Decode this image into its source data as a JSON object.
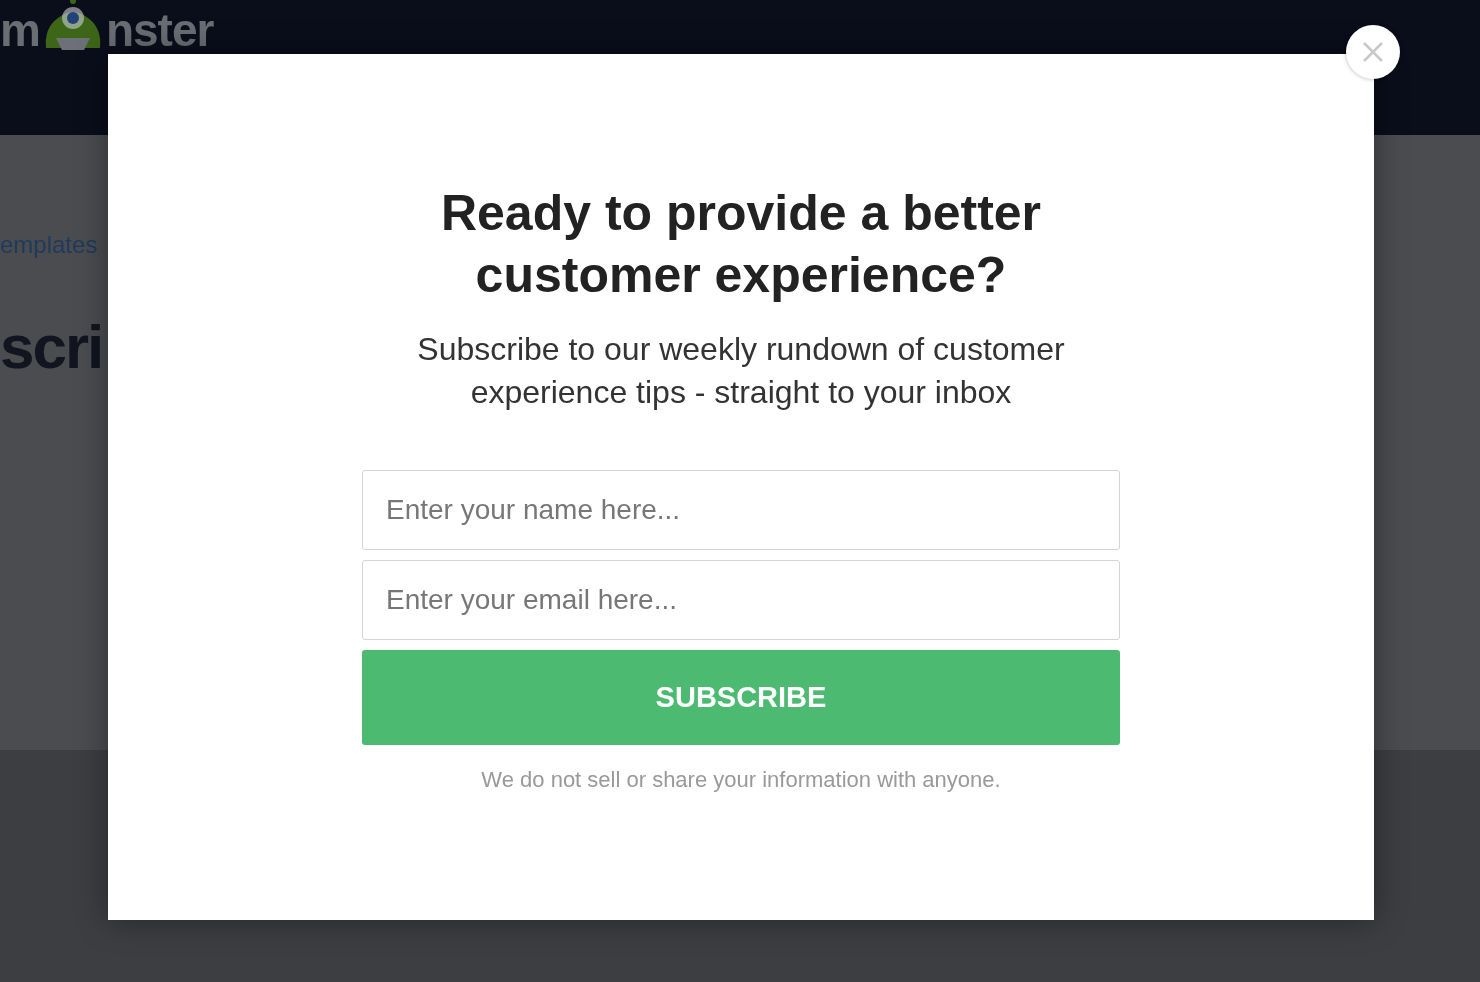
{
  "background": {
    "logo": {
      "text_before": "m",
      "text_after": "nster"
    },
    "breadcrumb": "emplates",
    "heading": "scri"
  },
  "modal": {
    "title": "Ready to provide a better customer experience?",
    "subtitle": "Subscribe to our weekly rundown of customer experience tips - straight to your inbox",
    "fields": [
      {
        "placeholder": "Enter your name here..."
      },
      {
        "placeholder": "Enter your email here..."
      }
    ],
    "button": "SUBSCRIBE",
    "disclaimer": "We do not sell or share your information with anyone."
  }
}
